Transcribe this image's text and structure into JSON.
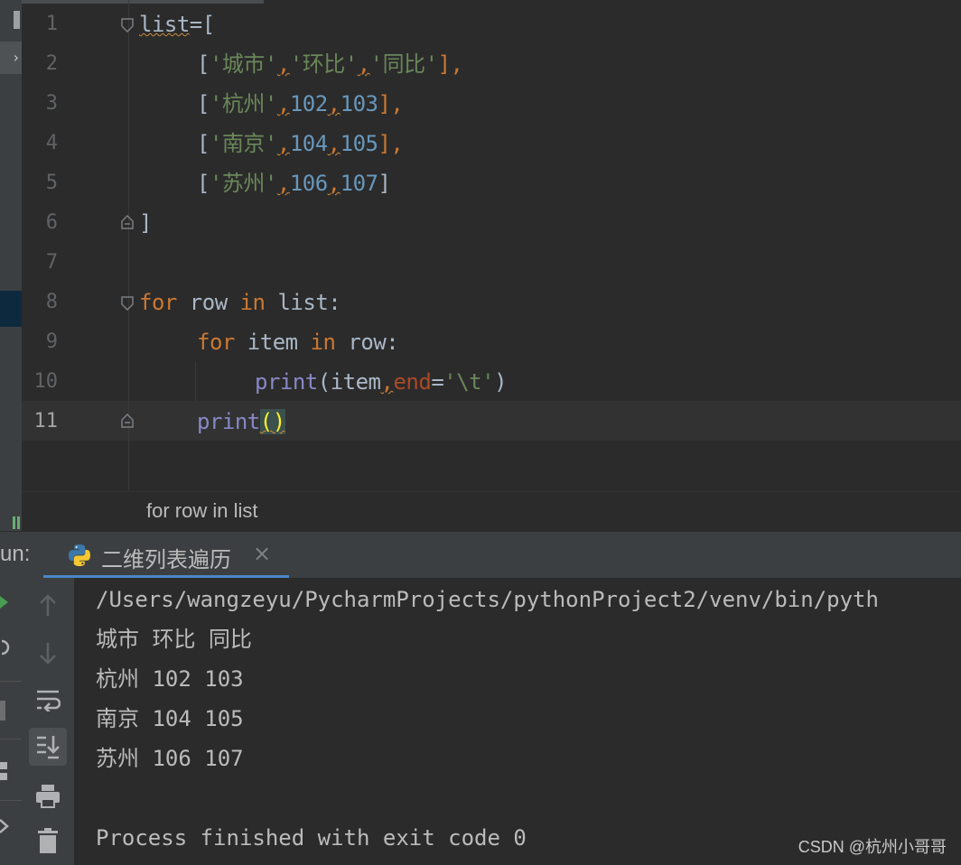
{
  "editor": {
    "line_numbers": [
      "1",
      "2",
      "3",
      "4",
      "5",
      "6",
      "7",
      "8",
      "9",
      "10",
      "11"
    ],
    "lines": {
      "l1": {
        "name": "list",
        "op": "=["
      },
      "l2": {
        "open": "[",
        "s1": "'城市'",
        "c1": ",",
        "s2": "'环比'",
        "c2": ",",
        "s3": "'同比'",
        "close": "],"
      },
      "l3": {
        "open": "[",
        "s1": "'杭州'",
        "c1": ",",
        "n1": "102",
        "c2": ",",
        "n2": "103",
        "close": "],"
      },
      "l4": {
        "open": "[",
        "s1": "'南京'",
        "c1": ",",
        "n1": "104",
        "c2": ",",
        "n2": "105",
        "close": "],"
      },
      "l5": {
        "open": "[",
        "s1": "'苏州'",
        "c1": ",",
        "n1": "106",
        "c2": ",",
        "n2": "107",
        "close": "]"
      },
      "l6": {
        "text": "]"
      },
      "l8": {
        "kw1": "for",
        "v1": " row ",
        "kw2": "in",
        "v2": " list:"
      },
      "l9": {
        "kw1": "for",
        "v1": " item ",
        "kw2": "in",
        "v2": " row:"
      },
      "l10": {
        "fn": "print",
        "p1": "(item",
        "comma": ",",
        "param": "end",
        "eq": "=",
        "str": "'\\t'",
        "p2": ")"
      },
      "l11": {
        "fn": "print",
        "parens": "()"
      }
    }
  },
  "breadcrumb": {
    "text": "for row in list"
  },
  "run": {
    "label": "un:",
    "tab_title": "二维列表遍历",
    "close_glyph": "×",
    "output": [
      "/Users/wangzeyu/PycharmProjects/pythonProject2/venv/bin/pyth",
      "城市 环比 同比",
      "杭州 102 103",
      "南京 104 105",
      "苏州 106 107",
      "",
      "Process finished with exit code 0"
    ]
  },
  "watermark": "CSDN @杭州小哥哥",
  "icons": [
    "python-file-icon",
    "scroll-up-icon",
    "scroll-down-icon",
    "soft-wrap-icon",
    "scroll-to-end-icon",
    "print-icon",
    "trash-icon",
    "fold-marker-icon"
  ],
  "colors": {
    "keyword": "#cc7832",
    "string": "#6a8759",
    "number": "#6897bb",
    "builtin": "#8888c6",
    "param": "#aa4926",
    "text": "#a9b7c6",
    "accent": "#4a88c7"
  }
}
